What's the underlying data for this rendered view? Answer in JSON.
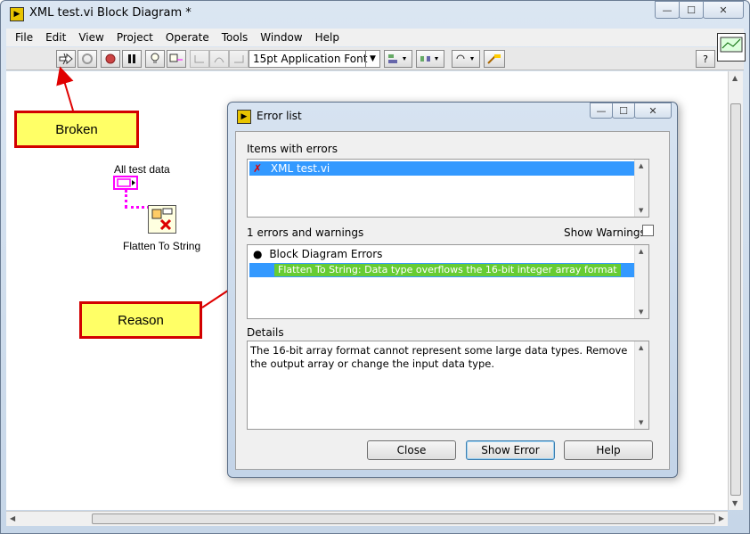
{
  "window": {
    "title": "XML test.vi Block Diagram *",
    "controls": {
      "minimize": "—",
      "maximize": "☐",
      "close": "✕"
    }
  },
  "menu": [
    "File",
    "Edit",
    "View",
    "Project",
    "Operate",
    "Tools",
    "Window",
    "Help"
  ],
  "toolbar": {
    "font": "15pt Application Font",
    "help": "?"
  },
  "annotations": {
    "broken": "Broken",
    "reason": "Reason"
  },
  "diagram": {
    "terminal_label": "All test data",
    "node_label": "Flatten To String"
  },
  "error_dialog": {
    "title": "Error list",
    "items_label": "Items with errors",
    "items": [
      "XML test.vi"
    ],
    "count_label": "1 errors and warnings",
    "show_warnings": "Show Warnings",
    "group": "Block Diagram Errors",
    "error": "Flatten To String: Data type overflows the 16-bit integer array format",
    "details_label": "Details",
    "details": "The 16-bit array format cannot represent some large data types. Remove the output array or change the input data type.",
    "buttons": {
      "close": "Close",
      "show_error": "Show Error",
      "help": "Help"
    }
  },
  "colors": {
    "callout_fill": "#ffff66",
    "callout_border": "#d20000",
    "selection": "#3399ff",
    "error_highlight": "#66cc33",
    "wire": "#ff00ff"
  }
}
